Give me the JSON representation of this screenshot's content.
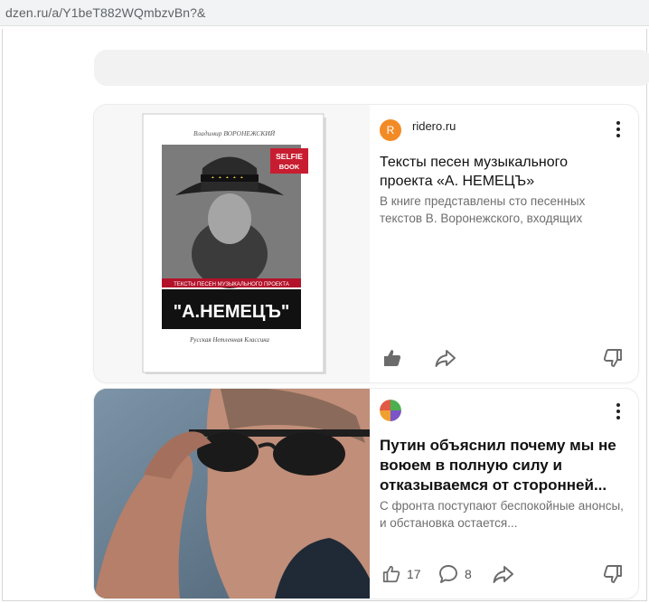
{
  "browser": {
    "url": "dzen.ru/a/Y1beT882WQmbzvBn?&"
  },
  "feed": {
    "cards": [
      {
        "source": "ridero.ru",
        "source_icon_letter": "R",
        "title": "Тексты песен музыкального проекта «А. НЕМЕЦЪ»",
        "snippet": "В книге представлены сто песенных текстов В. Воронежского, входящих",
        "book_cover": {
          "author": "Владимир ВОРОНЕЖСКИЙ",
          "badge_line1": "SELFIE",
          "badge_line2": "BOOK",
          "subtitle": "ТЕКСТЫ ПЕСЕН МУЗЫКАЛЬНОГО ПРОЕКТА",
          "project": "\"А.НЕМЕЦЪ\"",
          "series": "Русская Нетленная Классика"
        }
      },
      {
        "source": "",
        "title": "Путин объяснил почему мы не воюем в полную силу и отказываемся от сторонней...",
        "snippet": "С фронта поступают беспокойные анонсы, и обстановка остается...",
        "likes": "17",
        "comments": "8"
      }
    ]
  },
  "colors": {
    "source_icon": "#f28b26",
    "book_red": "#b3122a",
    "icon_gray": "#6b6b6b"
  },
  "icons": [
    "like-icon",
    "share-icon",
    "dislike-icon",
    "comment-icon",
    "more-vert-icon"
  ]
}
